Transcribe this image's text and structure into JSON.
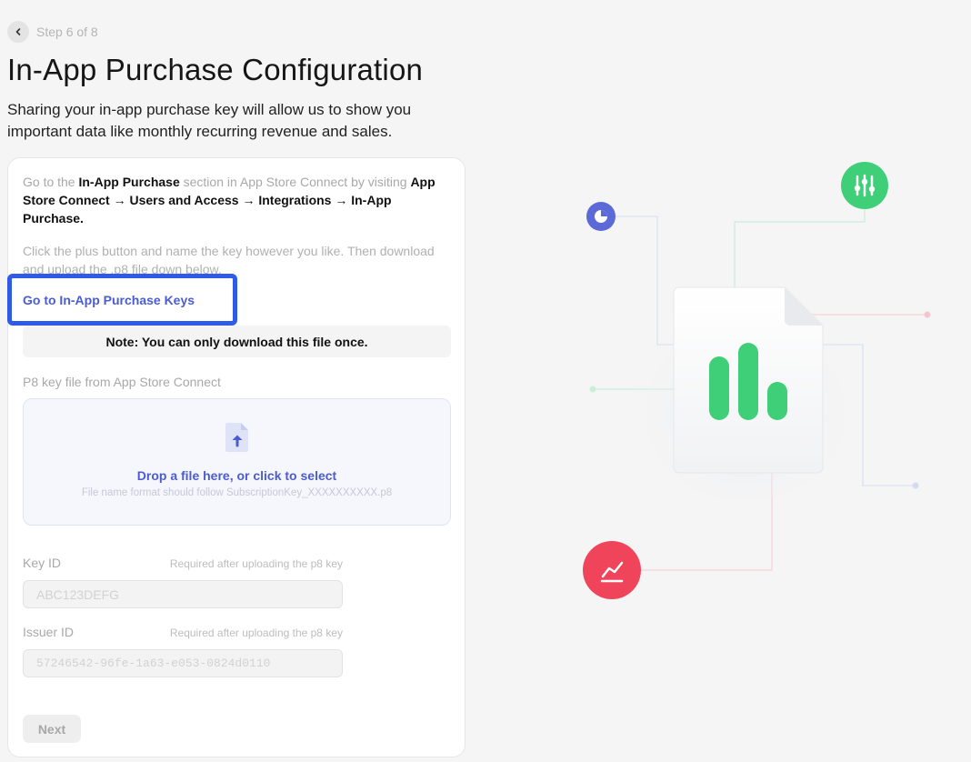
{
  "header": {
    "step_text": "Step 6 of 8",
    "title": "In-App Purchase Configuration",
    "subtitle": "Sharing your in-app purchase key will allow us to show you important data like monthly recurring revenue and sales."
  },
  "instructions": {
    "p1_a": "Go to the ",
    "p1_b": "In-App Purchase",
    "p1_c": " section in App Store Connect by visiting ",
    "p1_d": "App Store Connect → Users and Access → Integrations → In-App Purchase.",
    "p2": "Click the plus button and name the key however you like. Then download and upload the .p8 file down below."
  },
  "link_label": "Go to In-App Purchase Keys",
  "note": "Note: You can only download this file once.",
  "upload": {
    "label": "P8 key file from App Store Connect",
    "title": "Drop a file here, or click to select",
    "hint": "File name format should follow SubscriptionKey_XXXXXXXXXX.p8"
  },
  "key_id": {
    "label": "Key ID",
    "hint": "Required after uploading the p8 key",
    "placeholder": "ABC123DEFG"
  },
  "issuer_id": {
    "label": "Issuer ID",
    "hint": "Required after uploading the p8 key",
    "placeholder": "57246542-96fe-1a63-e053-0824d0110"
  },
  "next_label": "Next",
  "colors": {
    "accent": "#4a5ccf",
    "highlight_border": "#2f5be8",
    "green": "#3fcf78",
    "red": "#f0445a",
    "indigo": "#5c6ad8"
  },
  "icons": [
    "chevron-left-icon",
    "file-upload-icon",
    "pie-chart-icon",
    "sliders-icon",
    "trend-line-icon",
    "bar-chart-document-icon"
  ]
}
